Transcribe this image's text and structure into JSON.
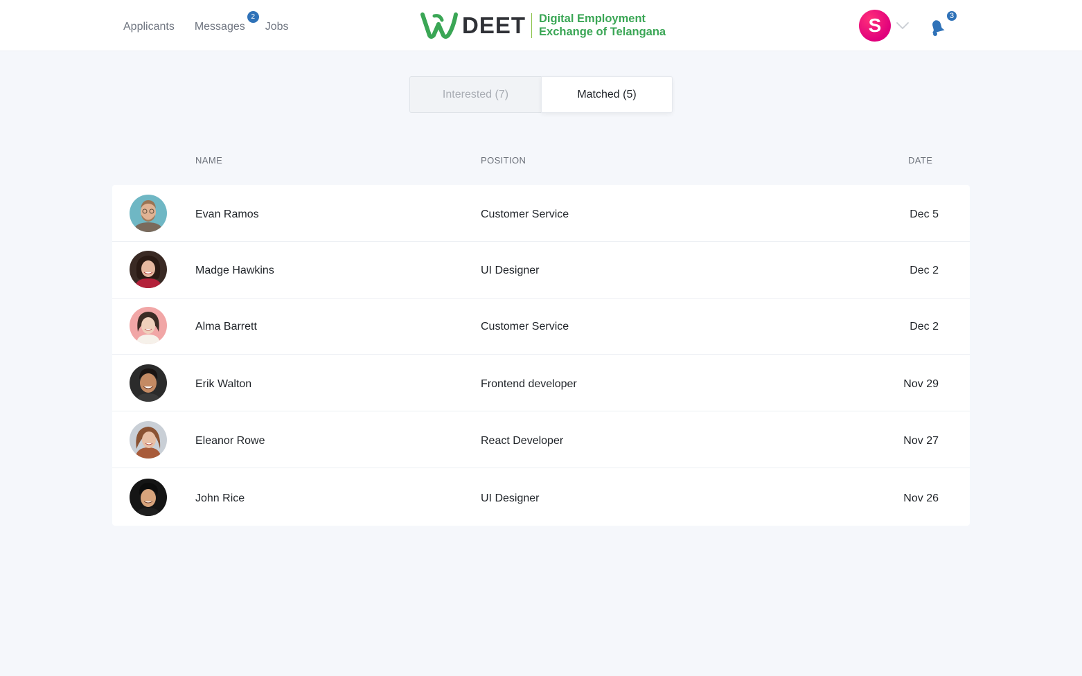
{
  "nav": {
    "items": [
      {
        "label": "Applicants"
      },
      {
        "label": "Messages",
        "badge": "2"
      },
      {
        "label": "Jobs"
      }
    ]
  },
  "brand": {
    "name": "DEET",
    "tagline_line1": "Digital Employment",
    "tagline_line2": "Exchange of Telangana",
    "color_primary": "#3aa655"
  },
  "user": {
    "avatar_letter": "S",
    "avatar_color": "#e0007c",
    "notifications_count": "3"
  },
  "tabs": [
    {
      "label": "Interested (7)",
      "active": false
    },
    {
      "label": "Matched (5)",
      "active": true
    }
  ],
  "table": {
    "columns": {
      "name": "NAME",
      "position": "POSITION",
      "date": "DATE"
    },
    "rows": [
      {
        "name": "Evan Ramos",
        "position": "Customer Service",
        "date": "Dec 5"
      },
      {
        "name": "Madge Hawkins",
        "position": "UI Designer",
        "date": "Dec 2"
      },
      {
        "name": "Alma Barrett",
        "position": "Customer Service",
        "date": "Dec 2"
      },
      {
        "name": "Erik Walton",
        "position": "Frontend developer",
        "date": "Nov 29"
      },
      {
        "name": "Eleanor Rowe",
        "position": "React Developer",
        "date": "Nov 27"
      },
      {
        "name": "John Rice",
        "position": "UI Designer",
        "date": "Nov 26"
      }
    ]
  }
}
